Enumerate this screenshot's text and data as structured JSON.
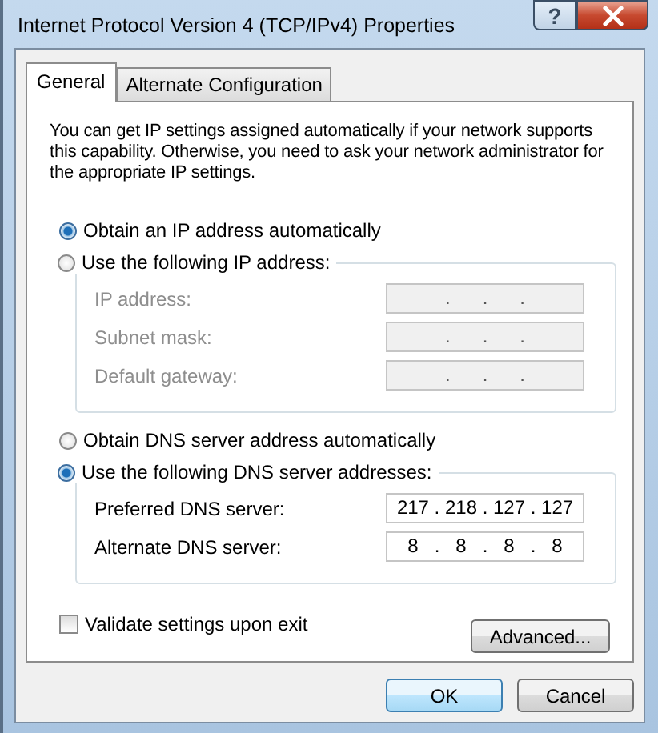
{
  "window": {
    "title": "Internet Protocol Version 4 (TCP/IPv4) Properties",
    "help_button": "?"
  },
  "tabs": [
    {
      "label": "General",
      "selected": true
    },
    {
      "label": "Alternate Configuration",
      "selected": false
    }
  ],
  "description": "You can get IP settings assigned automatically if your network supports this capability. Otherwise, you need to ask your network administrator for the appropriate IP settings.",
  "ip": {
    "auto": {
      "label": "Obtain an IP address automatically",
      "selected": true
    },
    "manual": {
      "label": "Use the following IP address:",
      "selected": false
    },
    "fields": [
      {
        "label": "IP address:",
        "value": ".      .      .",
        "disabled": true
      },
      {
        "label": "Subnet mask:",
        "value": ".      .      .",
        "disabled": true
      },
      {
        "label": "Default gateway:",
        "value": ".      .      .",
        "disabled": true
      }
    ]
  },
  "dns": {
    "auto": {
      "label": "Obtain DNS server address automatically",
      "selected": false
    },
    "manual": {
      "label": "Use the following DNS server addresses:",
      "selected": true
    },
    "fields": [
      {
        "label": "Preferred DNS server:",
        "value": "217 . 218 . 127 . 127",
        "disabled": false
      },
      {
        "label": "Alternate DNS server:",
        "value": "8   .   8   .   8   .   8",
        "disabled": false
      }
    ]
  },
  "validate": {
    "label": "Validate settings upon exit",
    "checked": false
  },
  "buttons": {
    "advanced": "Advanced...",
    "ok": "OK",
    "cancel": "Cancel"
  }
}
